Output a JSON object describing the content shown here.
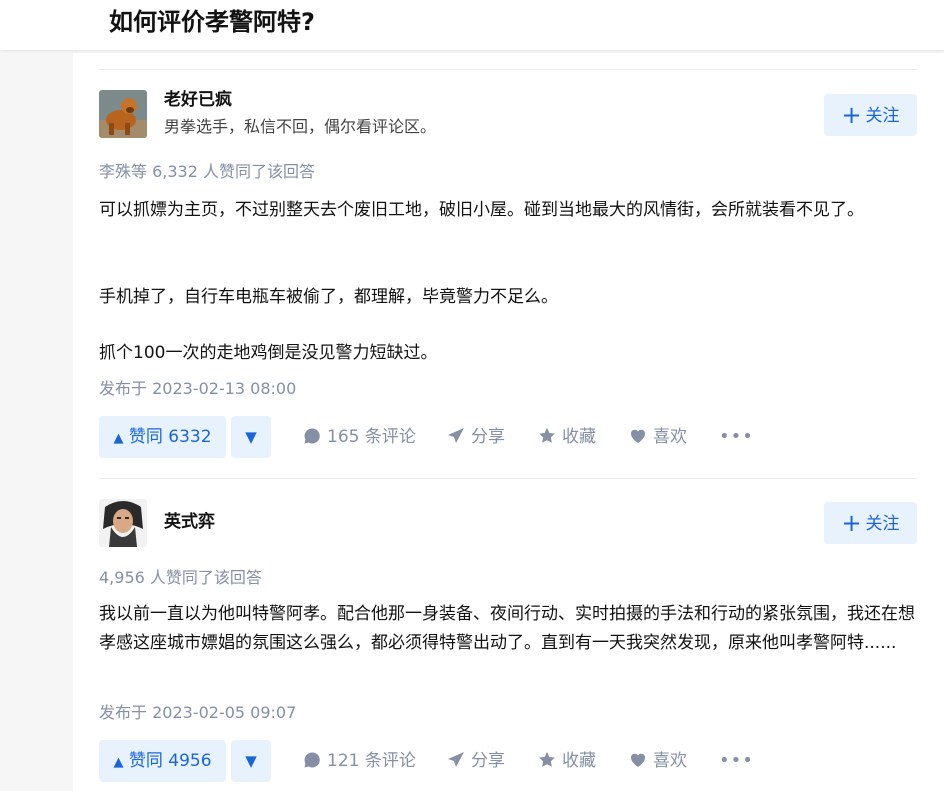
{
  "question": {
    "title": "如何评价孝警阿特?"
  },
  "answers": [
    {
      "author": {
        "name": "老好已疯",
        "bio": "男拳选手，私信不回，偶尔看评论区。"
      },
      "follow_label": "关注",
      "vote_summary": "李殊等 6,332 人赞同了该回答",
      "paragraphs": [
        "可以抓嫖为主页，不过别整天去个废旧工地，破旧小屋。碰到当地最大的风情街，会所就装看不见了。",
        "手机掉了，自行车电瓶车被偷了，都理解，毕竟警力不足么。",
        "抓个100一次的走地鸡倒是没见警力短缺过。"
      ],
      "published": "发布于 2023-02-13 08:00",
      "upvote_label": "赞同 6332",
      "comments_label": "165 条评论",
      "share_label": "分享",
      "favorite_label": "收藏",
      "like_label": "喜欢"
    },
    {
      "author": {
        "name": "英式弈",
        "bio": ""
      },
      "follow_label": "关注",
      "vote_summary": "4,956 人赞同了该回答",
      "paragraphs": [
        "我以前一直以为他叫特警阿孝。配合他那一身装备、夜间行动、实时拍摄的手法和行动的紧张氛围，我还在想孝感这座城市嫖娼的氛围这么强么，都必须得特警出动了。直到有一天我突然发现，原来他叫孝警阿特......"
      ],
      "published": "发布于 2023-02-05 09:07",
      "upvote_label": "赞同 4956",
      "comments_label": "121 条评论",
      "share_label": "分享",
      "favorite_label": "收藏",
      "like_label": "喜欢"
    }
  ],
  "colors": {
    "accent": "#1a66d9",
    "accent_bg": "#e8f2fd",
    "meta": "#8590a6"
  },
  "icons": [
    "plus-icon",
    "upvote-triangle-icon",
    "downvote-triangle-icon",
    "comment-icon",
    "share-icon",
    "star-icon",
    "heart-icon",
    "more-icon"
  ]
}
